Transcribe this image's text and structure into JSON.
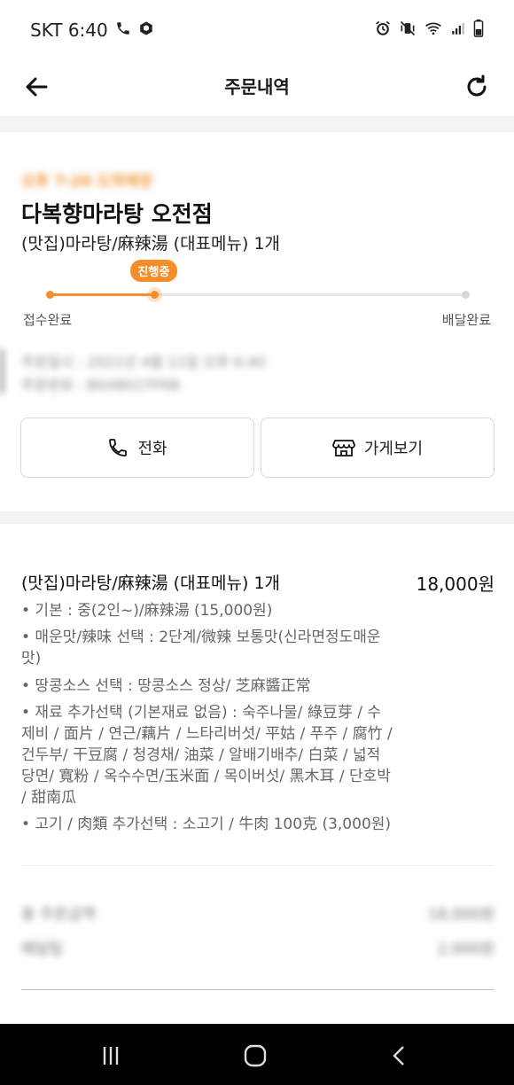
{
  "status_bar": {
    "carrier_time": "SKT 6:40"
  },
  "header": {
    "title": "주문내역"
  },
  "order": {
    "eta": "오후 7:20 도착예정",
    "store_name": "다복향마라탕 오전점",
    "summary": "(맛집)마라탕/麻辣湯 (대표메뉴) 1개",
    "progress": {
      "badge": "진행중",
      "fraction": 0.25,
      "start_label": "접수완료",
      "end_label": "배달완료"
    },
    "order_date": "주문일시 : 2021년 4월 11일 오후 6:40",
    "order_number": "주문번호 : B0XB01TFRB",
    "call_button": "전화",
    "store_button": "가게보기"
  },
  "item": {
    "name": "(맛집)마라탕/麻辣湯 (대표메뉴) 1개",
    "price": "18,000원",
    "options": [
      "• 기본 : 중(2인~)/麻辣湯 (15,000원)",
      "• 매운맛/辣味 선택 : 2단계/微辣 보통맛(신라면정도매운맛)",
      "• 땅콩소스 선택 : 땅콩소스 정상/ 芝麻醬正常",
      "• 재료 추가선택 (기본재료 없음) : 숙주나물/ 綠豆芽 / 수제비 / 面片 / 연근/藕片 / 느타리버섯/ 平姑 / 푸주 / 腐竹 / 건두부/ 干豆腐 / 청경채/ 油菜 / 알배기배추/ 白菜 / 넓적당면/ 寬粉 / 옥수수면/玉米面 / 목이버섯/ 黑木耳 / 단호박 / 甜南瓜",
      "• 고기 / 肉類 추가선택 : 소고기 / 牛肉 100克 (3,000원)"
    ]
  },
  "totals": {
    "order_total_label": "총 주문금액",
    "order_total_value": "18,000원",
    "delivery_label": "배달팁",
    "delivery_value": "2,000원"
  },
  "colors": {
    "accent": "#f58d2a",
    "track": "#e8e8e8"
  }
}
